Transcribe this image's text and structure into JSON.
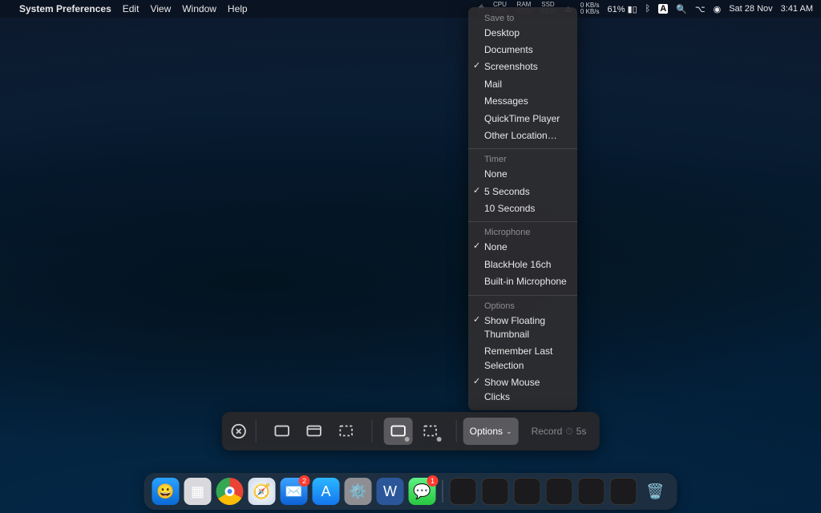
{
  "menubar": {
    "app_name": "System Preferences",
    "menus": [
      "Edit",
      "View",
      "Window",
      "Help"
    ],
    "stats": {
      "cpu_label": "CPU",
      "cpu_value": "27%",
      "ram_label": "RAM",
      "ram_value": "52%",
      "ssd_label": "SSD",
      "ssd_value": "63%",
      "net_up": "0 KB/s",
      "net_down": "0 KB/s",
      "battery": "61%"
    },
    "date": "Sat 28 Nov",
    "time": "3:41 AM"
  },
  "screenshot_bar": {
    "options_label": "Options",
    "record_label": "Record",
    "record_timer": "5s"
  },
  "options_menu": {
    "sections": [
      {
        "header": "Save to",
        "items": [
          {
            "label": "Desktop",
            "checked": false
          },
          {
            "label": "Documents",
            "checked": false
          },
          {
            "label": "Screenshots",
            "checked": true
          },
          {
            "label": "Mail",
            "checked": false
          },
          {
            "label": "Messages",
            "checked": false
          },
          {
            "label": "QuickTime Player",
            "checked": false
          },
          {
            "label": "Other Location…",
            "checked": false
          }
        ]
      },
      {
        "header": "Timer",
        "items": [
          {
            "label": "None",
            "checked": false
          },
          {
            "label": "5 Seconds",
            "checked": true
          },
          {
            "label": "10 Seconds",
            "checked": false
          }
        ]
      },
      {
        "header": "Microphone",
        "items": [
          {
            "label": "None",
            "checked": true
          },
          {
            "label": "BlackHole 16ch",
            "checked": false
          },
          {
            "label": "Built-in Microphone",
            "checked": false
          }
        ]
      },
      {
        "header": "Options",
        "items": [
          {
            "label": "Show Floating Thumbnail",
            "checked": true
          },
          {
            "label": "Remember Last Selection",
            "checked": false
          },
          {
            "label": "Show Mouse Clicks",
            "checked": true
          }
        ]
      }
    ]
  },
  "dock": {
    "apps": [
      "Finder",
      "Launchpad",
      "Chrome",
      "Safari",
      "Mail",
      "App Store",
      "System Preferences",
      "Word",
      "Messages"
    ],
    "badges": {
      "Mail": "2",
      "Messages": "1"
    },
    "right": [
      "Window thumb 1",
      "Window thumb 2",
      "Window thumb 3",
      "Window thumb 4",
      "Folder",
      "Downloads",
      "Trash"
    ]
  }
}
